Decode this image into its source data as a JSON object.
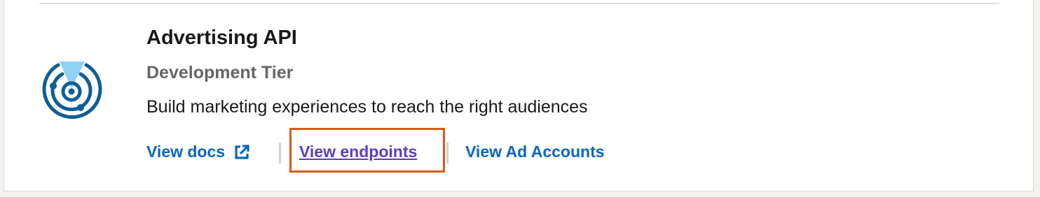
{
  "product": {
    "title": "Advertising API",
    "tier": "Development Tier",
    "description": "Build marketing experiences to reach the right audiences",
    "logo_icon": "radar-target-icon"
  },
  "links": {
    "docs_label": "View docs",
    "docs_icon": "external-link-icon",
    "endpoints_label": "View endpoints",
    "ad_accounts_label": "View Ad Accounts"
  },
  "colors": {
    "link": "#0a66c2",
    "visited_link": "#5a3fbf",
    "highlight_box": "#d95a10",
    "logo_primary": "#0e5e96",
    "logo_accent": "#8fd3f4"
  }
}
